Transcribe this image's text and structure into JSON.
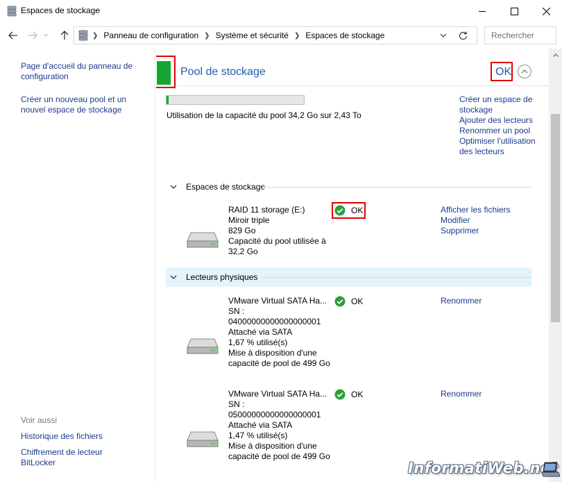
{
  "window": {
    "title": "Espaces de stockage"
  },
  "nav": {
    "breadcrumbs": [
      "Panneau de configuration",
      "Système et sécurité",
      "Espaces de stockage"
    ],
    "search_placeholder": "Rechercher"
  },
  "sidebar": {
    "links": [
      "Page d'accueil du panneau de configuration",
      "Créer un nouveau pool et un nouvel espace de stockage"
    ],
    "see_also_heading": "Voir aussi",
    "see_also": [
      "Historique des fichiers",
      "Chiffrement de lecteur BitLocker"
    ]
  },
  "pool": {
    "title": "Pool de stockage",
    "status": "OK",
    "usage_text": "Utilisation de la capacité du pool 34,2 Go sur 2,43 To",
    "usage_fraction": 0.014,
    "actions": [
      "Créer un espace de stockage",
      "Ajouter des lecteurs",
      "Renommer un pool",
      "Optimiser l'utilisation des lecteurs"
    ]
  },
  "spaces_section": {
    "label": "Espaces de stockage",
    "items": [
      {
        "lines": [
          "RAID 11 storage (E:)",
          "Miroir triple",
          "829 Go",
          "Capacité du pool utilisée à 32,2 Go"
        ],
        "status": "OK",
        "actions": [
          "Afficher les fichiers",
          "Modifier",
          "Supprimer"
        ]
      }
    ]
  },
  "drives_section": {
    "label": "Lecteurs physiques",
    "items": [
      {
        "lines": [
          "VMware Virtual SATA Ha...",
          "SN :",
          "04000000000000000001",
          "Attaché via SATA",
          "1,67 % utilisé(s)",
          "Mise à disposition d'une capacité de pool de 499 Go"
        ],
        "status": "OK",
        "actions": [
          "Renommer"
        ]
      },
      {
        "lines": [
          "VMware Virtual SATA Ha...",
          "SN :",
          "05000000000000000001",
          "Attaché via SATA",
          "1,47 % utilisé(s)",
          "Mise à disposition d'une capacité de pool de 499 Go"
        ],
        "status": "OK",
        "actions": [
          "Renommer"
        ]
      }
    ]
  },
  "watermark": "InformatiWeb.net"
}
